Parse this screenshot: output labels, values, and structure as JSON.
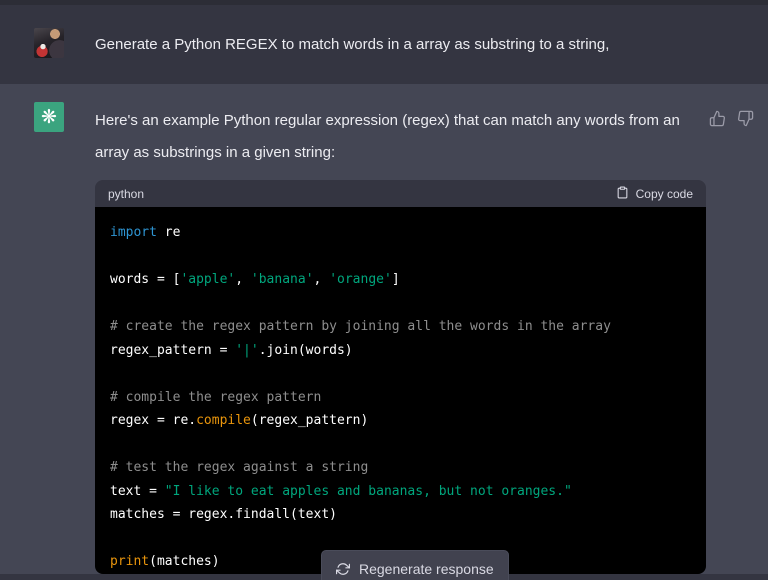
{
  "colors": {
    "bg-main": "#343541",
    "bg-assistant": "#444654",
    "bg-code": "#000000",
    "bg-code-header": "#343541",
    "bg-top-edge": "#2c2d36",
    "bg-button": "#41424f",
    "text-primary": "#ececf1",
    "text-secondary": "#d9d9e3",
    "icon-muted": "#9b9ba8",
    "avatar-assistant-bg": "#3ba47f",
    "tok-keyword": "#2e95d3",
    "tok-string": "#00a67d",
    "tok-comment": "#8e8e8e",
    "tok-function": "#e9950c",
    "tok-plain": "#ffffff"
  },
  "user_message": {
    "text": "Generate a Python REGEX to match words in a array as substring to a string,"
  },
  "assistant_message": {
    "text": "Here's an example Python regular expression (regex) that can match any words from an array as substrings in a given string:",
    "feedback": {
      "thumbs_up_icon": "thumbs-up",
      "thumbs_down_icon": "thumbs-down"
    }
  },
  "assistant_avatar": {
    "icon": "openai-logo",
    "glyph": "❋"
  },
  "code_block": {
    "language_label": "python",
    "copy_button": {
      "icon": "clipboard",
      "label": "Copy code"
    },
    "lines": [
      {
        "tokens": [
          {
            "text": "import",
            "type": "kw"
          },
          {
            "text": " re",
            "type": "pl"
          }
        ]
      },
      {
        "tokens": []
      },
      {
        "tokens": [
          {
            "text": "words = [",
            "type": "pl"
          },
          {
            "text": "'apple'",
            "type": "str"
          },
          {
            "text": ", ",
            "type": "pl"
          },
          {
            "text": "'banana'",
            "type": "str"
          },
          {
            "text": ", ",
            "type": "pl"
          },
          {
            "text": "'orange'",
            "type": "str"
          },
          {
            "text": "]",
            "type": "pl"
          }
        ]
      },
      {
        "tokens": []
      },
      {
        "tokens": [
          {
            "text": "# create the regex pattern by joining all the words in the array",
            "type": "cm"
          }
        ]
      },
      {
        "tokens": [
          {
            "text": "regex_pattern = ",
            "type": "pl"
          },
          {
            "text": "'|'",
            "type": "str"
          },
          {
            "text": ".join(words)",
            "type": "pl"
          }
        ]
      },
      {
        "tokens": []
      },
      {
        "tokens": [
          {
            "text": "# compile the regex pattern",
            "type": "cm"
          }
        ]
      },
      {
        "tokens": [
          {
            "text": "regex = re.",
            "type": "pl"
          },
          {
            "text": "compile",
            "type": "fn"
          },
          {
            "text": "(regex_pattern)",
            "type": "pl"
          }
        ]
      },
      {
        "tokens": []
      },
      {
        "tokens": [
          {
            "text": "# test the regex against a string",
            "type": "cm"
          }
        ]
      },
      {
        "tokens": [
          {
            "text": "text = ",
            "type": "pl"
          },
          {
            "text": "\"I like to eat apples and bananas, but not oranges.\"",
            "type": "str"
          }
        ]
      },
      {
        "tokens": [
          {
            "text": "matches = regex.findall(text)",
            "type": "pl"
          }
        ]
      },
      {
        "tokens": []
      },
      {
        "tokens": [
          {
            "text": "print",
            "type": "fn"
          },
          {
            "text": "(matches)",
            "type": "pl"
          }
        ]
      }
    ]
  },
  "regenerate_button": {
    "icon": "refresh",
    "label": "Regenerate response"
  }
}
